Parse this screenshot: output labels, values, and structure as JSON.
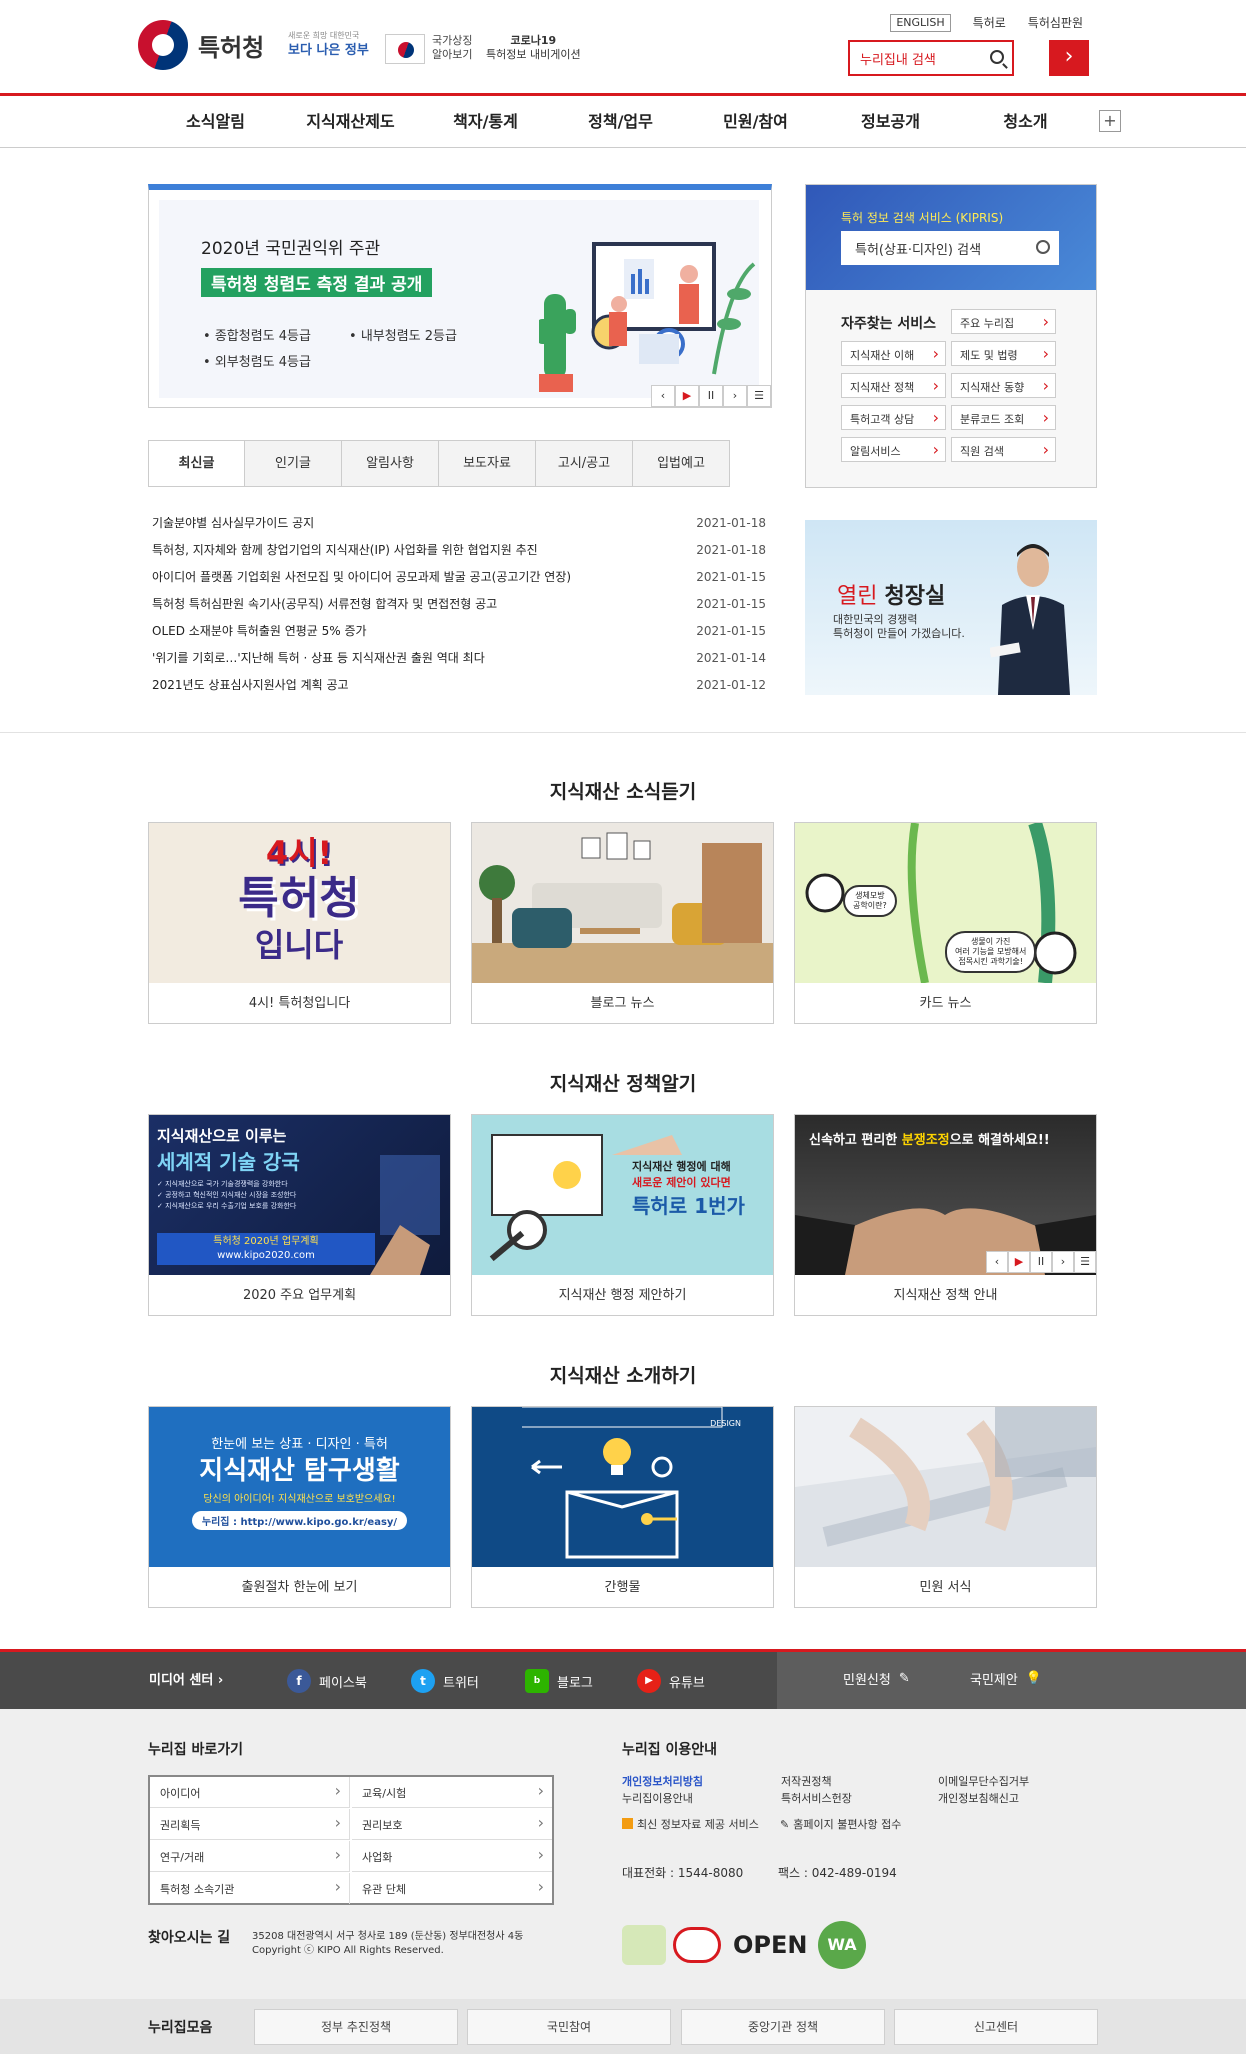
{
  "header": {
    "logo_text": "특허청",
    "gov_slogan_top": "새로운 희망 대한민국",
    "gov_slogan": "보다 나은 정부",
    "national_symbol_label": "국가상징 알아보기",
    "covid_title": "코로나19",
    "covid_sub": "특허정보 내비게이션",
    "top_links": [
      "ENGLISH",
      "특허로",
      "특허심판원"
    ],
    "search_placeholder": "누리집내 검색",
    "search_go": "›"
  },
  "gnb": [
    "소식알림",
    "지식재산제도",
    "책자/통계",
    "정책/업무",
    "민원/참여",
    "정보공개",
    "청소개"
  ],
  "gnb_more": "+",
  "visual": {
    "year_text": "2020년 국민권익위 주관",
    "title": "특허청 청렴도 측정 결과 공개",
    "bullets": [
      "종합청렴도 4등급",
      "내부청렴도 2등급",
      "외부청렴도 4등급"
    ],
    "controls": [
      "‹",
      "▶",
      "II",
      "›",
      "☰"
    ]
  },
  "kipris": {
    "title": "특허 정보 검색 서비스 (KIPRIS)",
    "search_label": "특허(상표·디자인) 검색",
    "fav_title": "자주찾는 서비스",
    "buttons": [
      "주요 누리집",
      "지식재산 이해",
      "제도 및 법령",
      "지식재산 정책",
      "지식재산 동향",
      "특허고객 상담",
      "분류코드 조회",
      "알림서비스",
      "직원 검색"
    ]
  },
  "tabs": [
    "최신글",
    "인기글",
    "알림사항",
    "보도자료",
    "고시/공고",
    "입법예고"
  ],
  "news": [
    {
      "title": "기술분야별 심사실무가이드 공지",
      "date": "2021-01-18"
    },
    {
      "title": "특허청, 지자체와 함께 창업기업의 지식재산(IP) 사업화를 위한 협업지원 추진",
      "date": "2021-01-18"
    },
    {
      "title": "아이디어 플랫폼 기업회원 사전모집 및 아이디어 공모과제 발굴 공고(공고기간 연장)",
      "date": "2021-01-15"
    },
    {
      "title": "특허청 특허심판원 속기사(공무직) 서류전형 합격자 및 면접전형 공고",
      "date": "2021-01-15"
    },
    {
      "title": "OLED 소재분야 특허출원 연평균 5% 증가",
      "date": "2021-01-15"
    },
    {
      "title": "'위기를 기회로…'지난해 특허 · 상표 등 지식재산권 출원 역대 최다",
      "date": "2021-01-14"
    },
    {
      "title": "2021년도 상표심사지원사업 계획 공고",
      "date": "2021-01-12"
    }
  ],
  "ceo": {
    "title_a": "열린",
    "title_b": "청장실",
    "desc_1": "대한민국의 경쟁력",
    "desc_2": "특허청이 만들어 가겠습니다."
  },
  "sections": [
    {
      "title": "지식재산 소식듣기",
      "cards": [
        {
          "caption": "4시! 특허청입니다",
          "art_lines": [
            "4시!",
            "특허청",
            "입니다"
          ]
        },
        {
          "caption": "블로그 뉴스"
        },
        {
          "caption": "카드 뉴스",
          "art_lines": [
            "생체모방",
            "공학이란?",
            "생물이 가진",
            "여러 기능을 모방해서",
            "접목시킨 과학기술!"
          ]
        }
      ]
    },
    {
      "title": "지식재산 정책알기",
      "cards": [
        {
          "caption": "2020 주요 업무계획",
          "art_lines": [
            "지식재산으로 이루는",
            "세계적 기술 강국",
            "✓ 지식재산으로 국가 기술경쟁력을 강화한다",
            "✓ 공정하고 혁신적인 지식재산 시장을 조성한다",
            "✓ 지식재산으로 우리 수출기업 보호를 강화한다",
            "특허청 2020년 업무계획",
            "www.kipo2020.com"
          ]
        },
        {
          "caption": "지식재산 행정 제안하기",
          "art_lines": [
            "지식재산 행정에 대해",
            "새로운 제안이 있다면",
            "특허로 1번가"
          ]
        },
        {
          "caption": "지식재산 정책 안내",
          "art_lines": [
            "신속하고 편리한",
            "분쟁조정",
            "으로 해결하세요!!"
          ]
        }
      ]
    },
    {
      "title": "지식재산 소개하기",
      "cards": [
        {
          "caption": "출원절차 한눈에 보기",
          "art_lines": [
            "한눈에 보는 상표 · 디자인 · 특허",
            "지식재산 탐구생활",
            "당신의 아이디어! 지식재산으로 보호받으세요!",
            "누리집 : http://www.kipo.go.kr/easy/"
          ]
        },
        {
          "caption": "간행물",
          "art_lines": [
            "DESIGN"
          ]
        },
        {
          "caption": "민원 서식"
        }
      ]
    }
  ],
  "card_controls": [
    "‹",
    "▶",
    "II",
    "›",
    "☰"
  ],
  "media": {
    "label": "미디어 센터 ›",
    "links": [
      "페이스북",
      "트위터",
      "블로그",
      "유튜브"
    ],
    "right_links": [
      "민원신청",
      "국민제안"
    ]
  },
  "footer": {
    "shortcut_title": "누리집 바로가기",
    "shortcuts": [
      "아이디어",
      "교육/시험",
      "권리획득",
      "권리보호",
      "연구/거래",
      "사업화",
      "특허청 소속기관",
      "유관 단체"
    ],
    "guide_title": "누리집 이용안내",
    "guide_links": [
      "개인정보처리방침",
      "저작권정책",
      "이메일무단수집거부",
      "누리집이용안내",
      "특허서비스헌장",
      "개인정보침해신고"
    ],
    "rss": "최신 정보자료 제공 서비스",
    "complaint": "홈페이지 불편사항 접수",
    "tel": "대표전화 : 1544-8080",
    "fax": "팩스 : 042-489-0194",
    "location_title": "찾아오시는 길",
    "address": "35208 대전광역시 서구 청사로 189 (둔산동) 정부대전청사 4동",
    "copyright": "Copyright ⓒ KIPO All Rights Reserved.",
    "cert_open": "OPEN",
    "cert_wa": "WA"
  },
  "bottom": {
    "label": "누리집모음",
    "buttons": [
      "정부 추진정책",
      "국민참여",
      "중앙기관 정책",
      "신고센터"
    ]
  },
  "colors": {
    "accent": "#d7191f",
    "kipris_blue": "#3a6fca",
    "green": "#23a160"
  }
}
